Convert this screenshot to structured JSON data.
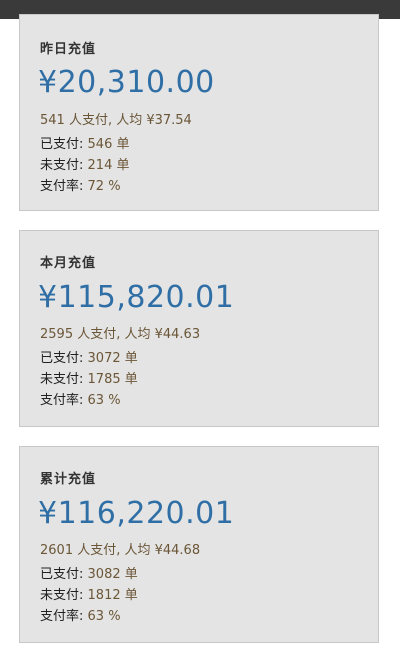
{
  "cards": [
    {
      "title": "昨日充值",
      "amount": "¥20,310.00",
      "summary": "541 人支付, 人均 ¥37.54",
      "paid_label": "已支付:",
      "paid_value": "546 单",
      "unpaid_label": "未支付:",
      "unpaid_value": "214 单",
      "rate_label": "支付率:",
      "rate_value": "72 %"
    },
    {
      "title": "本月充值",
      "amount": "¥115,820.01",
      "summary": "2595 人支付, 人均 ¥44.63",
      "paid_label": "已支付:",
      "paid_value": "3072 单",
      "unpaid_label": "未支付:",
      "unpaid_value": "1785 单",
      "rate_label": "支付率:",
      "rate_value": "63 %"
    },
    {
      "title": "累计充值",
      "amount": "¥116,220.01",
      "summary": "2601 人支付, 人均 ¥44.68",
      "paid_label": "已支付:",
      "paid_value": "3082 单",
      "unpaid_label": "未支付:",
      "unpaid_value": "1812 单",
      "rate_label": "支付率:",
      "rate_value": "63 %"
    }
  ]
}
